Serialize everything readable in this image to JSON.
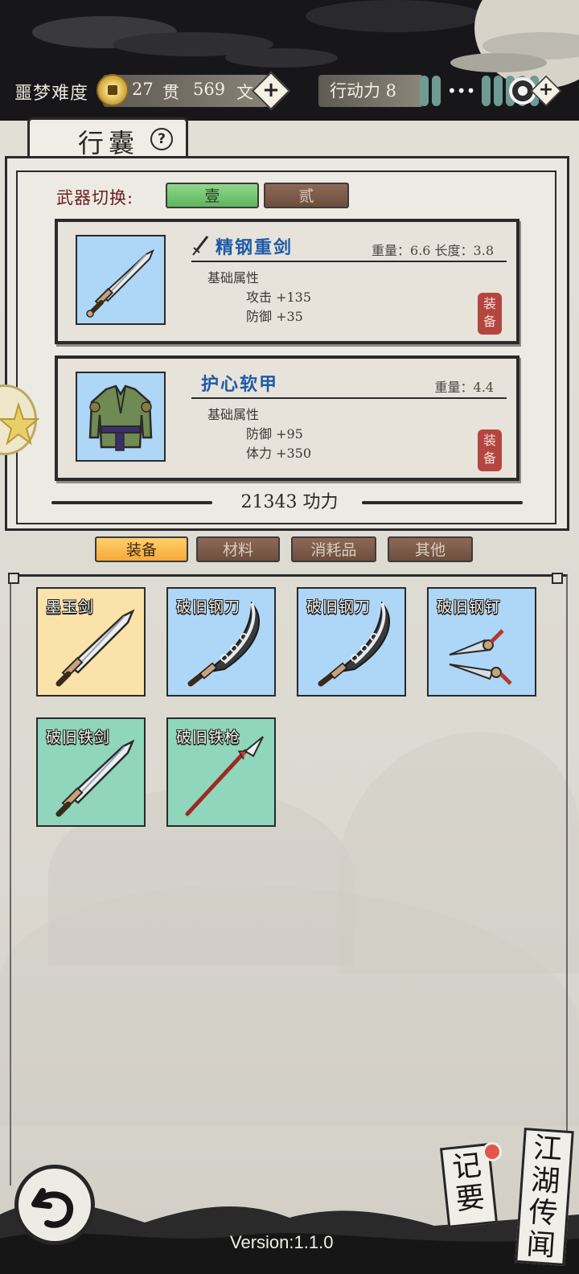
{
  "header": {
    "difficulty": "噩梦难度",
    "money": {
      "guan_value": "27",
      "guan_unit": "贯",
      "wen_value": "569",
      "wen_unit": "文"
    },
    "action_points": "行动力 8"
  },
  "bag": {
    "title": "行囊",
    "help_icon": "?",
    "weapon_switch": {
      "label": "武器切换:",
      "options": [
        "壹",
        "贰"
      ],
      "active": "壹"
    },
    "equipped": [
      {
        "name": "精钢重剑",
        "meta": "重量：6.6  长度：3.8",
        "section": "基础属性",
        "attrs": [
          "攻击 +135",
          "防御 +35"
        ],
        "stamp": "装备",
        "icon": "sword-icon"
      },
      {
        "name": "护心软甲",
        "meta": "重量：4.4",
        "section": "基础属性",
        "attrs": [
          "防御 +95",
          "体力 +350"
        ],
        "stamp": "装备",
        "icon": "armor-icon"
      }
    ],
    "power": "21343 功力"
  },
  "inventory": {
    "tabs": [
      "装备",
      "材料",
      "消耗品",
      "其他"
    ],
    "active_tab": "装备",
    "items": [
      {
        "name": "墨玉剑",
        "rarity": "gold",
        "icon": "sword-icon"
      },
      {
        "name": "破旧钢刀",
        "rarity": "blue",
        "icon": "saber-icon"
      },
      {
        "name": "破旧钢刀",
        "rarity": "blue",
        "icon": "saber-icon"
      },
      {
        "name": "破旧钢钉",
        "rarity": "blue",
        "icon": "dart-icon"
      },
      {
        "name": "破旧铁剑",
        "rarity": "green",
        "icon": "sword-icon"
      },
      {
        "name": "破旧铁枪",
        "rarity": "green",
        "icon": "spear-icon"
      }
    ]
  },
  "footer": {
    "notes": "记要",
    "rumors": "江湖传闻",
    "version": "Version:1.1.0"
  }
}
